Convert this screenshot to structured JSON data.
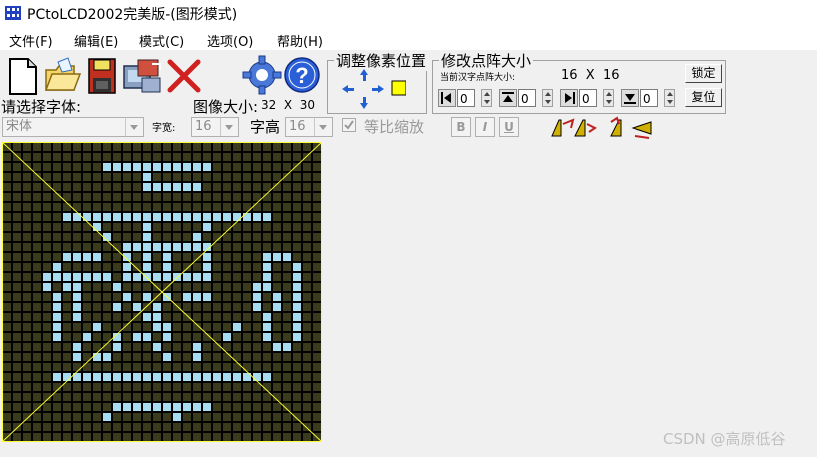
{
  "window": {
    "title": "PCtoLCD2002完美版-(图形模式)"
  },
  "menu": {
    "items": [
      {
        "label": "文件(F)"
      },
      {
        "label": "编辑(E)"
      },
      {
        "label": "模式(C)"
      },
      {
        "label": "选项(O)"
      },
      {
        "label": "帮助(H)"
      }
    ]
  },
  "toolbar": {
    "icons": [
      "new-file-icon",
      "open-folder-icon",
      "save-floppy-icon",
      "batch-generate-icon",
      "delete-x-icon",
      "settings-gear-icon",
      "help-question-icon"
    ],
    "adjust_group_title": "调整像素位置",
    "resize_group": {
      "title": "修改点阵大小",
      "current_label": "当前汉字点阵大小:",
      "current_size": "16  X  16",
      "lock_label": "锁定",
      "restore_label": "复位",
      "spin_values": [
        "0",
        "0",
        "0",
        "0"
      ]
    },
    "font_select_label": "请选择字体:",
    "font_value": "宋体",
    "char_width_label": "字宽:",
    "char_width_value": "16",
    "image_size_label": "图像大小:",
    "image_size_value": "32  X  30",
    "char_height_label": "字高",
    "char_height_value": "16",
    "keep_ratio_label": "等比缩放",
    "format_buttons": [
      "B",
      "I",
      "U"
    ]
  },
  "canvas": {
    "columns": 32,
    "rows": 30,
    "grid_color": "#000000",
    "background_color": "#3a3a1c",
    "pixel_on_color": "#a8dcf0",
    "diagonal_color": "#ffff33",
    "pattern": [
      "00000000000000000000000000000000",
      "00000000000000000000000000000000",
      "00000000001111111111100000000000",
      "00000000000000100000000000000000",
      "00000000000000111111000000000000",
      "00000000000000000000000000000000",
      "00000000000000000000000000000000",
      "00000011111111111111111111100000",
      "00000000010000100000100000000000",
      "00000000001000100001000000000000",
      "00000000000011111111100000000000",
      "00000011110010101000100000111000",
      "00000100000010101000100000100100",
      "00001111111011111111100000100100",
      "00001011000100000000000001100100",
      "00000101000010101011100001010100",
      "00000101000101010000000001010100",
      "00000101000000110000000000100100",
      "00000100010000011000000100100100",
      "00000100100101101000001000100100",
      "00000001000100010001000000011000",
      "00000001011000001001000000000000",
      "00000000000000000000000000000000",
      "00000111111111111111111111100000",
      "00000000000000000000000000000000",
      "00000000000000000000000000000000",
      "00000000000111111111100000000000",
      "00000000001000000100000000000000",
      "00000000000000000000000000000000",
      "00000000000000000000000000000000"
    ]
  },
  "watermark": "CSDN @高原低谷"
}
